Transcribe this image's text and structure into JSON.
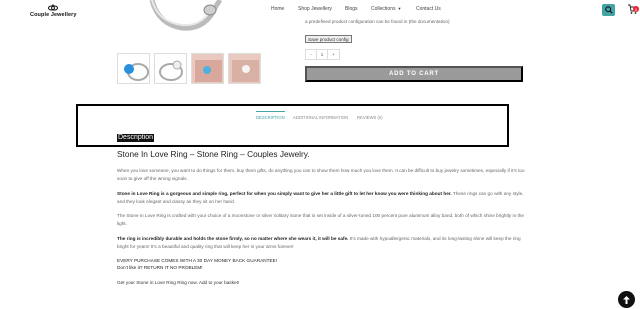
{
  "brand": {
    "name": "Couple Jewellery"
  },
  "nav": {
    "items": [
      {
        "label": "Home"
      },
      {
        "label": "Shop Jewellery"
      },
      {
        "label": "Blogs"
      },
      {
        "label": "Collections"
      },
      {
        "label": "Contact Us"
      }
    ]
  },
  "cart": {
    "count": "0"
  },
  "product": {
    "config_note": "a predefined product configuration can be found in (the documentation)",
    "save_config_label": "Save product config",
    "quantity": {
      "minus": "-",
      "value": "1",
      "plus": "+"
    },
    "add_to_cart_label": "ADD TO CART"
  },
  "tabs": {
    "items": [
      {
        "label": "DESCRIPTION",
        "active": true
      },
      {
        "label": "ADDITIONAL INFORMATION",
        "active": false
      },
      {
        "label": "REVIEWS (0)",
        "active": false
      }
    ],
    "active_heading": "Description"
  },
  "description": {
    "title": "Stone In Love Ring – Stone Ring – Couples Jewelry.",
    "p1": "When you love someone, you want to do things for them, buy them gifts, do anything you can to show them how much you love them.  It can be difficult to buy jewelry sometimes, especially if it’s too soon to give off the wrong signals.",
    "p2_bold": "Stone in Love Ring is a gorgeous and simple ring, perfect for when you simply want to give her a little gift to let her know you were thinking about her.",
    "p2_rest": "  These rings can go with any style, and they look elegant and classy as they sit on her hand.",
    "p3": "The Stone in Love Ring is crafted with your choice of a moonstone or silver solitary stone that is set inside of a silver-toned 100 percent pure aluminum alloy band, both of which shine brightly in the light.",
    "p4_bold": "The ring is incredibly durable and holds the stone firmly, so no matter where she wears it, it will be safe.",
    "p4_rest": "  It’s made with hypoallergenic materials, and its long-lasting shine will keep the ring bright for years! It’s a beautiful and quality ring that will keep her in your arms forever!",
    "guarantee_line1": "EVERY PURCHASE COMES WITH A 30 DAY MONEY BACK GUARANTEE!",
    "guarantee_line2": "Don’t like it?  RETURN IT NO PROBLEM!",
    "closing": "Get your Stone in Love Ring Ring now. Add to your basket!"
  },
  "colors": {
    "accent": "#43a3a6",
    "button_gray": "#9a9a9a",
    "badge": "#e22233"
  },
  "icons": [
    "ring-logo-icon",
    "search-icon",
    "cart-icon",
    "chevron-down-icon",
    "arrow-up-icon"
  ]
}
